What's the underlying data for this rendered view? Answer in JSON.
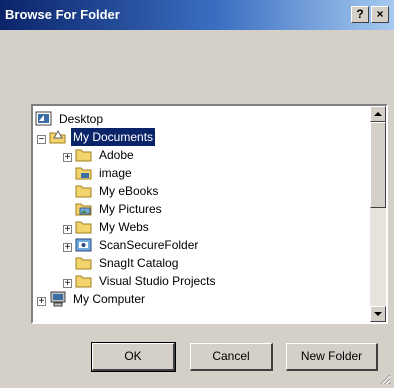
{
  "window": {
    "title": "Browse For Folder",
    "help_label": "?",
    "close_label": "×"
  },
  "tree": {
    "items": [
      {
        "label": "Desktop",
        "icon": "desktop-icon"
      },
      {
        "label": "My Documents",
        "icon": "my-documents-icon",
        "selected": true
      },
      {
        "label": "Adobe",
        "icon": "folder-icon"
      },
      {
        "label": "image",
        "icon": "image-folder-icon"
      },
      {
        "label": "My eBooks",
        "icon": "folder-icon"
      },
      {
        "label": "My Pictures",
        "icon": "pictures-folder-icon"
      },
      {
        "label": "My Webs",
        "icon": "folder-icon"
      },
      {
        "label": "ScanSecureFolder",
        "icon": "secure-folder-icon"
      },
      {
        "label": "SnagIt Catalog",
        "icon": "folder-icon"
      },
      {
        "label": "Visual Studio Projects",
        "icon": "folder-icon"
      },
      {
        "label": "My Computer",
        "icon": "computer-icon"
      }
    ],
    "expanders": {
      "minus": "−",
      "plus": "+"
    }
  },
  "buttons": {
    "ok": "OK",
    "cancel": "Cancel",
    "new_folder": "New Folder"
  },
  "colors": {
    "title_start": "#0a246a",
    "title_end": "#a6caf0",
    "selection": "#0a246a",
    "folder": "#f3d36b",
    "face": "#d4d0c8"
  }
}
